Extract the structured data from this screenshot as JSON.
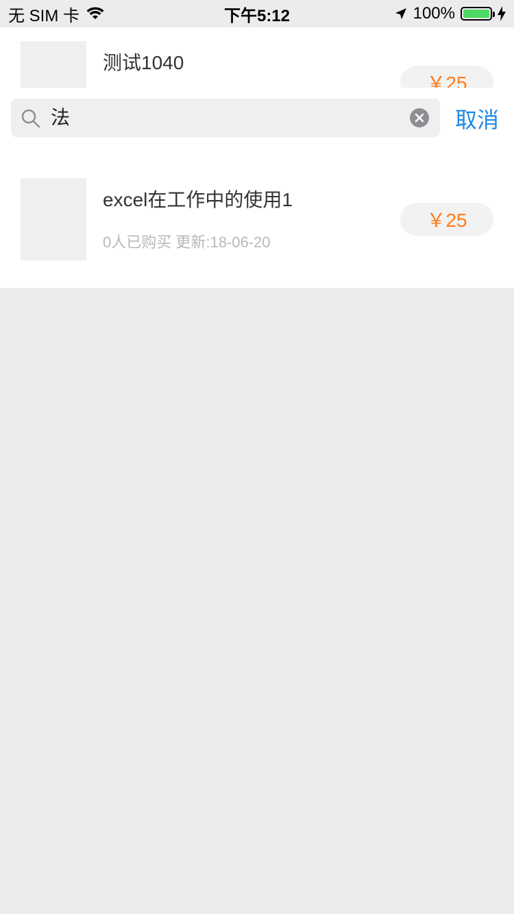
{
  "status_bar": {
    "carrier": "无 SIM 卡",
    "time": "下午5:12",
    "battery": "100%"
  },
  "search": {
    "query": "法",
    "cancel_label": "取消"
  },
  "courses": [
    {
      "title": "测试1040",
      "meta": "",
      "price": "￥25"
    },
    {
      "title": "excel在工作中的使用1",
      "meta": "0人已购买 更新:18-06-20",
      "price": "￥25"
    }
  ],
  "colors": {
    "accent": "#1e88e5",
    "price": "#ff7a1a",
    "battery": "#4cd964"
  }
}
